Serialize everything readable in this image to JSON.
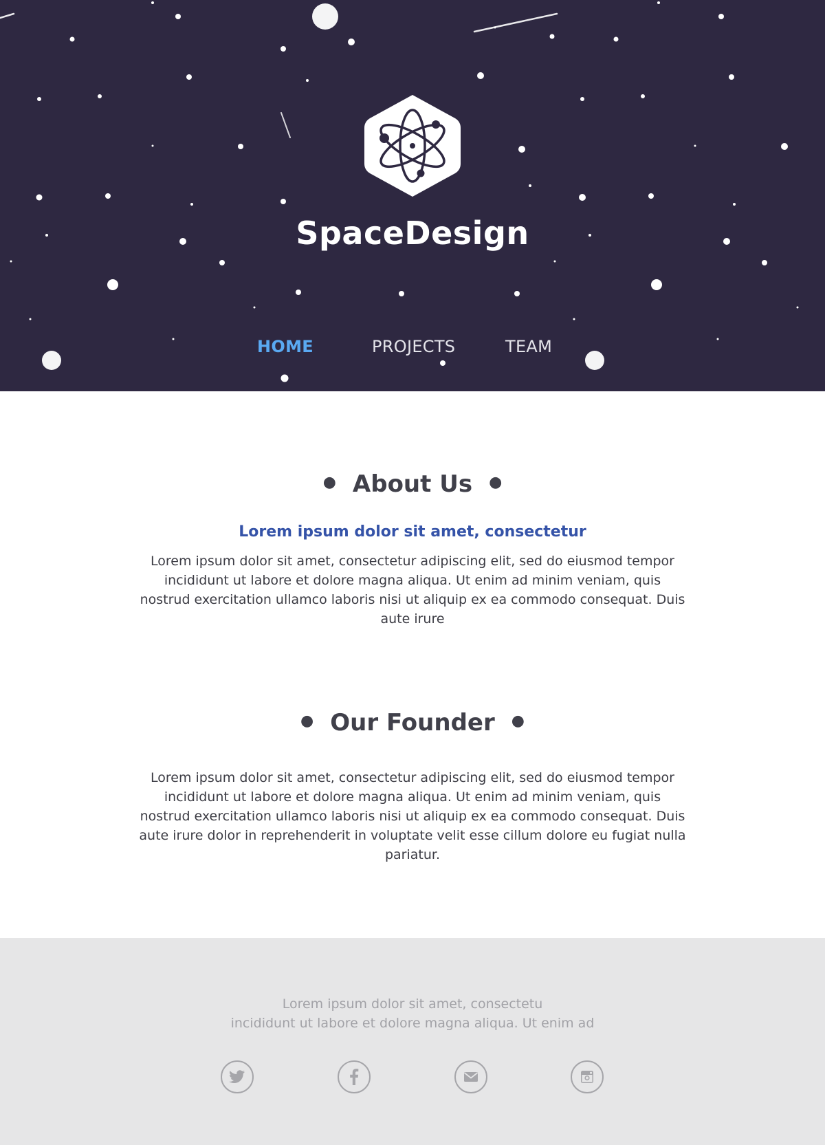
{
  "brand": {
    "name": "SpaceDesign",
    "logo_icon": "atom-icon"
  },
  "nav": {
    "items": [
      {
        "label": "HOME",
        "active": true
      },
      {
        "label": "PROJECTS",
        "active": false
      },
      {
        "label": "TEAM",
        "active": false
      }
    ]
  },
  "about": {
    "title": "About Us",
    "subtitle": "Lorem ipsum dolor sit amet, consectetur",
    "text": "Lorem ipsum dolor sit amet, consectetur adipiscing elit, sed do eiusmod tempor incididunt ut labore et dolore magna aliqua. Ut enim ad minim veniam, quis nostrud exercitation ullamco laboris nisi ut aliquip ex ea commodo consequat. Duis aute irure"
  },
  "founder": {
    "title": "Our Founder",
    "text": "Lorem ipsum dolor sit amet, consectetur adipiscing elit, sed do eiusmod tempor incididunt ut labore et dolore magna aliqua. Ut enim ad minim veniam, quis nostrud exercitation ullamco laboris nisi ut aliquip ex ea commodo consequat. Duis aute irure dolor in reprehenderit in voluptate velit esse cillum dolore eu fugiat nulla pariatur."
  },
  "footer": {
    "line1": "Lorem ipsum dolor sit amet, consectetu",
    "line2": "incididunt ut labore et dolore magna aliqua. Ut enim ad",
    "social": [
      "twitter-icon",
      "facebook-icon",
      "mail-icon",
      "instagram-icon"
    ]
  },
  "colors": {
    "hero_bg": "#2e2841",
    "nav_active": "#5aa9f2",
    "subtitle": "#3553a8",
    "footer_bg": "#e6e6e7"
  }
}
